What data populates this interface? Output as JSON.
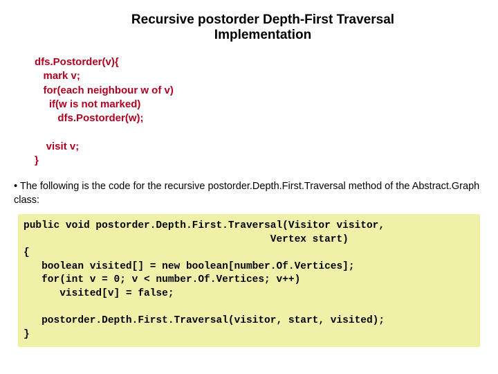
{
  "title": "Recursive postorder Depth-First Traversal Implementation",
  "pseudo": "dfs.Postorder(v){\n   mark v;\n   for(each neighbour w of v)\n     if(w is not marked)\n        dfs.Postorder(w);\n\n    visit v;\n}",
  "desc": "• The following is the code for the recursive postorder.Depth.First.Traversal method of the Abstract.Graph class:",
  "code": "public void postorder.Depth.First.Traversal(Visitor visitor,\n                                         Vertex start)\n{\n   boolean visited[] = new boolean[number.Of.Vertices];\n   for(int v = 0; v < number.Of.Vertices; v++)\n      visited[v] = false;\n\n   postorder.Depth.First.Traversal(visitor, start, visited);\n}"
}
